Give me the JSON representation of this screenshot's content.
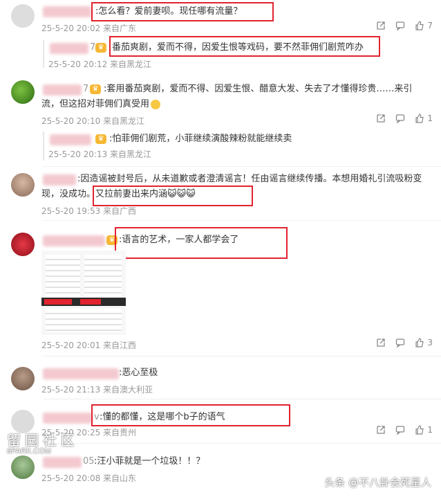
{
  "comments": [
    {
      "text": ":怎么看？爱前妻呗。现任哪有流量？",
      "meta": "25-5-20 20:02 来自广东",
      "likes": "7",
      "replies": [
        {
          "text": "番茄爽剧，爱而不得，因爱生恨等戏码，要不然菲佣们剧荒咋办",
          "meta": "25-5-20 20:12 来自黑龙江"
        }
      ]
    },
    {
      "text_line1": ":套用番茄爽剧，爱而不得、因爱生恨、醋意大发、失去了才懂得珍贵……来引",
      "text_line2": "流，但这招对菲佣们真受用",
      "meta": "25-5-20 20:10 来自黑龙江",
      "likes": "1",
      "replies": [
        {
          "text": ":怕菲佣们剧荒，小菲继续演酸辣粉就能继续卖",
          "meta": "25-5-20 20:13 来自黑龙江"
        }
      ]
    },
    {
      "text_line1": ":因造谣被封号后，从未道歉或者澄清谣言！任由谣言继续传播。本想用婚礼引流吸粉变",
      "text_line2": "现，没成功。又拉前妻出来内涵",
      "emoji": "😺😺😺",
      "meta": "25-5-20 19:53 来自广西"
    },
    {
      "text": ":语言的艺术，一家人都学会了",
      "meta": "25-5-20 20:01 来自江西",
      "likes": "3"
    },
    {
      "text": ":恶心至极",
      "meta": "25-5-20 21:13 来自澳大利亚"
    },
    {
      "text": "懂的都懂，这是哪个b子的语气",
      "prefix": "v",
      "meta": "25-5-20 20:25 来自贵州",
      "likes": "1"
    },
    {
      "text": ":汪小菲就是一个垃圾！！？",
      "prefix": "05",
      "meta": "25-5-20 20:08 来自山东"
    }
  ],
  "partial_name_suffixes": [
    "7",
    "7"
  ],
  "watermark_left": "留园社区",
  "watermark_left_sub": "6PARK.COM",
  "watermark_right": "头条 @不八卦会死星人",
  "colors": {
    "highlight": "#e0232e",
    "meta": "#999999"
  }
}
